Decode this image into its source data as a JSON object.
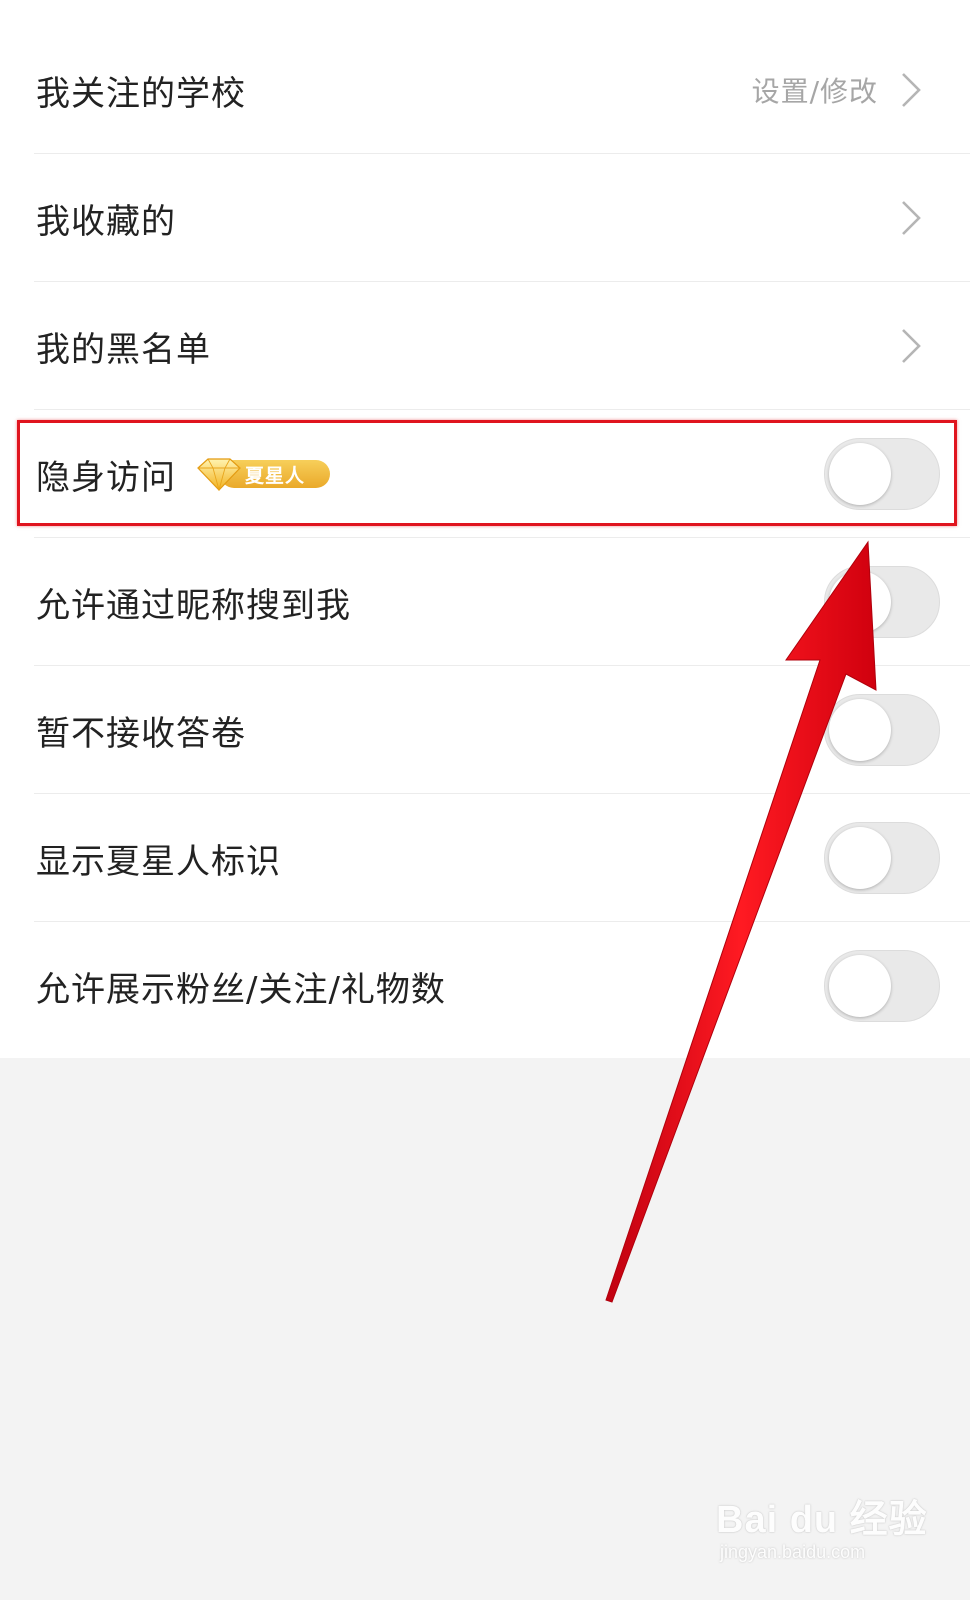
{
  "settings": {
    "rows": [
      {
        "label": "我关注的学校",
        "hint": "设置/修改",
        "control": "chevron"
      },
      {
        "label": "我收藏的",
        "control": "chevron"
      },
      {
        "label": "我的黑名单",
        "control": "chevron"
      },
      {
        "label": "隐身访问",
        "badge": "夏星人",
        "control": "toggle",
        "on": false
      },
      {
        "label": "允许通过昵称搜到我",
        "control": "toggle",
        "on": false
      },
      {
        "label": "暂不接收答卷",
        "control": "toggle",
        "on": false
      },
      {
        "label": "显示夏星人标识",
        "control": "toggle",
        "on": false
      },
      {
        "label": "允许展示粉丝/关注/礼物数",
        "control": "toggle",
        "on": false
      }
    ]
  },
  "watermark": {
    "logo": "Bai du 经验",
    "url": "jingyan.baidu.com"
  },
  "colors": {
    "annotation_red": "#e0141e",
    "badge_gold": "#f0b93a",
    "toggle_off": "#e9e9e9",
    "text_primary": "#222222",
    "text_hint": "#a6a6a6"
  }
}
